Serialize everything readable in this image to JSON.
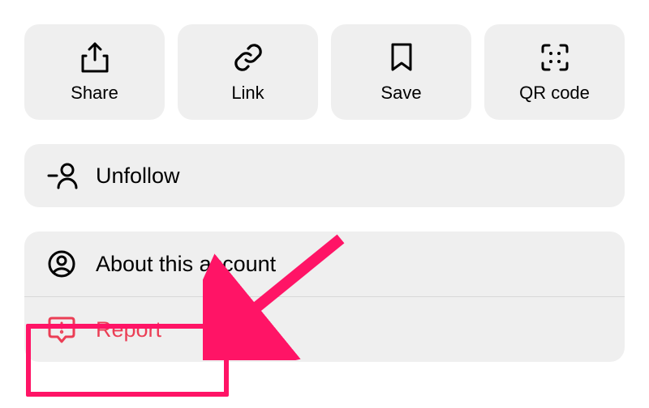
{
  "actions": {
    "share_label": "Share",
    "link_label": "Link",
    "save_label": "Save",
    "qrcode_label": "QR code"
  },
  "group1": {
    "unfollow_label": "Unfollow"
  },
  "group2": {
    "about_label": "About this account",
    "report_label": "Report"
  },
  "colors": {
    "card_bg": "#EFEFEF",
    "danger": "#EB3E55",
    "highlight": "#FF1466"
  }
}
